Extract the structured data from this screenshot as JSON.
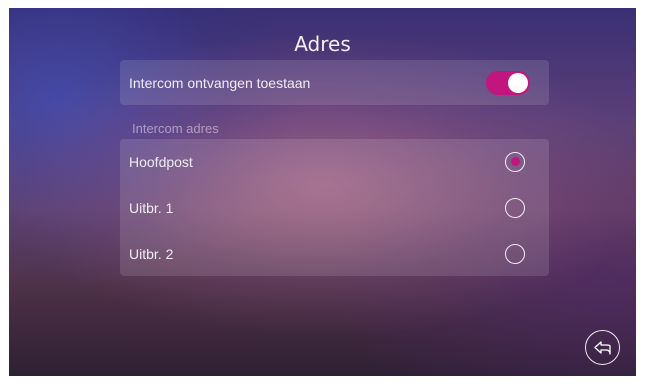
{
  "header": {
    "title": "Adres"
  },
  "intercom_toggle": {
    "label": "Intercom ontvangen toestaan",
    "enabled": true
  },
  "address_section": {
    "label": "Intercom adres",
    "options": [
      {
        "label": "Hoofdpost",
        "selected": true
      },
      {
        "label": "Uitbr. 1",
        "selected": false
      },
      {
        "label": "Uitbr. 2",
        "selected": false
      }
    ]
  },
  "colors": {
    "accent": "#c2157d"
  },
  "icons": {
    "back": "back-arrow-icon"
  }
}
